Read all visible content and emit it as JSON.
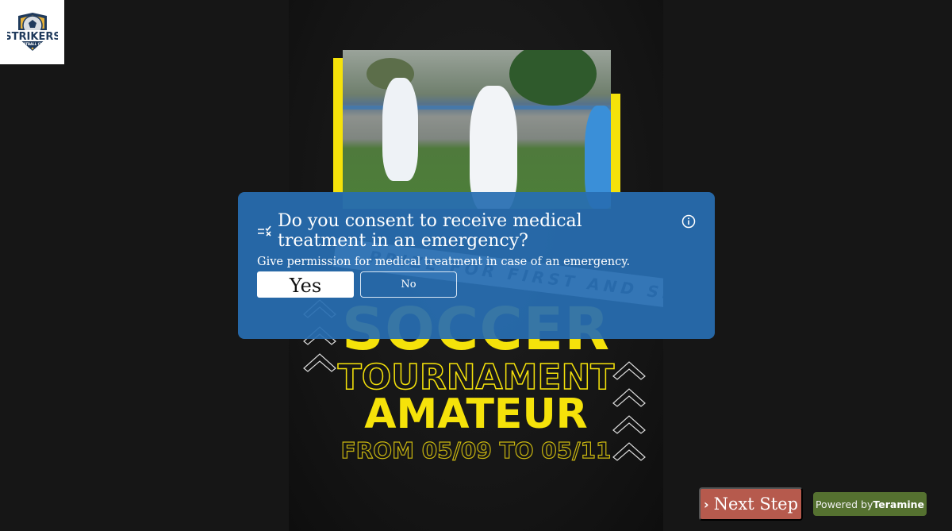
{
  "brand": {
    "logo_text": "STRIKERS",
    "logo_subtext": "FOOTBALL CLUB",
    "colors": {
      "navy": "#1f3a5c",
      "gold": "#e8b23a"
    }
  },
  "poster": {
    "banner_text": "PRIZE FOR FIRST AND SECOND PLACE",
    "headline": "SOCCER",
    "subheadline": "TOURNAMENT",
    "level": "AMATEUR",
    "dates": "FROM 05/09 TO 05/11",
    "accent_color": "#f5e20a"
  },
  "modal": {
    "question_icon": "checklist-icon",
    "question": "Do you consent to receive medical treatment in an emergency?",
    "info_icon": "info-icon",
    "description": "Give permission for medical treatment in case of an emergency.",
    "options": [
      {
        "label": "Yes",
        "selected": true
      },
      {
        "label": "No",
        "selected": false
      }
    ],
    "background_color": "#286eb2"
  },
  "footer": {
    "next_label": "Next Step",
    "next_icon": "chevron-right-icon",
    "powered_prefix": "Powered by",
    "powered_brand": "Teramine",
    "next_color": "#b65a4d",
    "powered_color": "#557130"
  }
}
